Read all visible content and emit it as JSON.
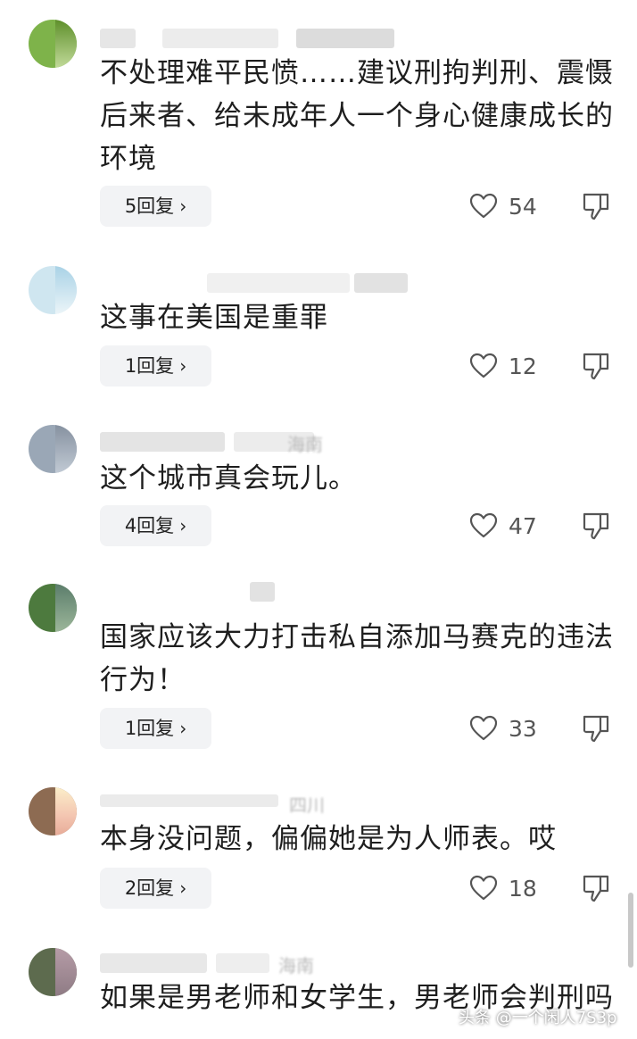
{
  "comments": [
    {
      "meta": "",
      "text": "不处理难平民愤……建议刑拘判刑、震慑后来者、给未成年人一个身心健康成长的环境",
      "reply_label": "5回复",
      "likes": "54",
      "avatar_color": "#7eb34a"
    },
    {
      "meta": "",
      "text": "这事在美国是重罪",
      "reply_label": "1回复",
      "likes": "12",
      "avatar_color": "#a9d2e6"
    },
    {
      "meta": "海南",
      "text": "这个城市真会玩儿。",
      "reply_label": "4回复",
      "likes": "47",
      "avatar_color": "#9aa7b6"
    },
    {
      "meta": "",
      "text": "国家应该大力打击私自添加马赛克的违法行为！",
      "reply_label": "1回复",
      "likes": "33",
      "avatar_color": "#4d7a3e"
    },
    {
      "meta": "四川",
      "text": "本身没问题，偏偏她是为人师表。哎",
      "reply_label": "2回复",
      "likes": "18",
      "avatar_color": "#8d6b52"
    },
    {
      "meta": "海南",
      "text": "如果是男老师和女学生，男老师会判刑吗",
      "reply_label": "",
      "likes": "",
      "avatar_color": "#5d6b4e"
    }
  ],
  "icons": {
    "like": "heart-outline-icon",
    "dislike": "thumbs-down-icon",
    "reply_chevron": "chevron-right-icon"
  },
  "watermark": "头条 @一个闲人7S3p"
}
